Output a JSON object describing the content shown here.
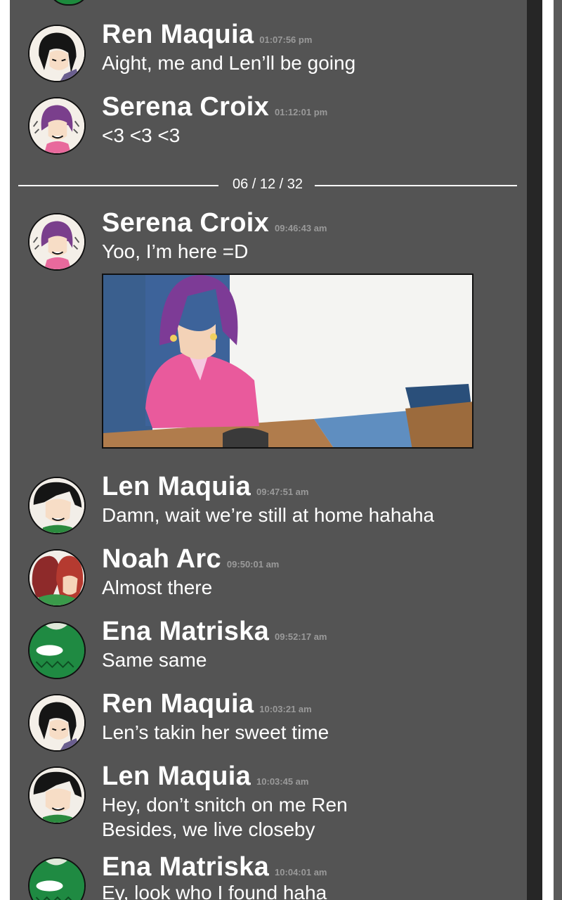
{
  "date_separator": "06 / 12 / 32",
  "messages": [
    {
      "name": "Ren Maquia",
      "time": "01:07:56 pm",
      "lines": [
        "Aight, me and Len’ll be going"
      ],
      "avatar": "ren-avatar"
    },
    {
      "name": "Serena Croix",
      "time": "01:12:01 pm",
      "lines": [
        "<3 <3 <3"
      ],
      "avatar": "serena-avatar"
    },
    {
      "name": "Serena Croix",
      "time": "09:46:43 am",
      "lines": [
        "Yoo, I’m here =D"
      ],
      "avatar": "serena-avatar",
      "attachment": "photo-woman-in-pink-shirt-at-table"
    },
    {
      "name": "Len Maquia",
      "time": "09:47:51 am",
      "lines": [
        "Damn, wait we’re still at home hahaha"
      ],
      "avatar": "len-avatar"
    },
    {
      "name": "Noah Arc",
      "time": "09:50:01 am",
      "lines": [
        "Almost there"
      ],
      "avatar": "noah-avatar"
    },
    {
      "name": "Ena Matriska",
      "time": "09:52:17 am",
      "lines": [
        "Same same"
      ],
      "avatar": "ena-avatar"
    },
    {
      "name": "Ren Maquia",
      "time": "10:03:21 am",
      "lines": [
        "Len’s takin her sweet time"
      ],
      "avatar": "ren-avatar"
    },
    {
      "name": "Len Maquia",
      "time": "10:03:45 am",
      "lines": [
        "Hey, don’t snitch on me Ren",
        "Besides, we live closeby"
      ],
      "avatar": "len-avatar"
    },
    {
      "name": "Ena Matriska",
      "time": "10:04:01 am",
      "lines": [
        "Ey, look who I found haha"
      ],
      "avatar": "ena-avatar"
    }
  ],
  "colors": {
    "panel_bg": "#545454",
    "text": "#ffffff",
    "timestamp": "#9a9a9a",
    "scrollbar": "#262626"
  }
}
